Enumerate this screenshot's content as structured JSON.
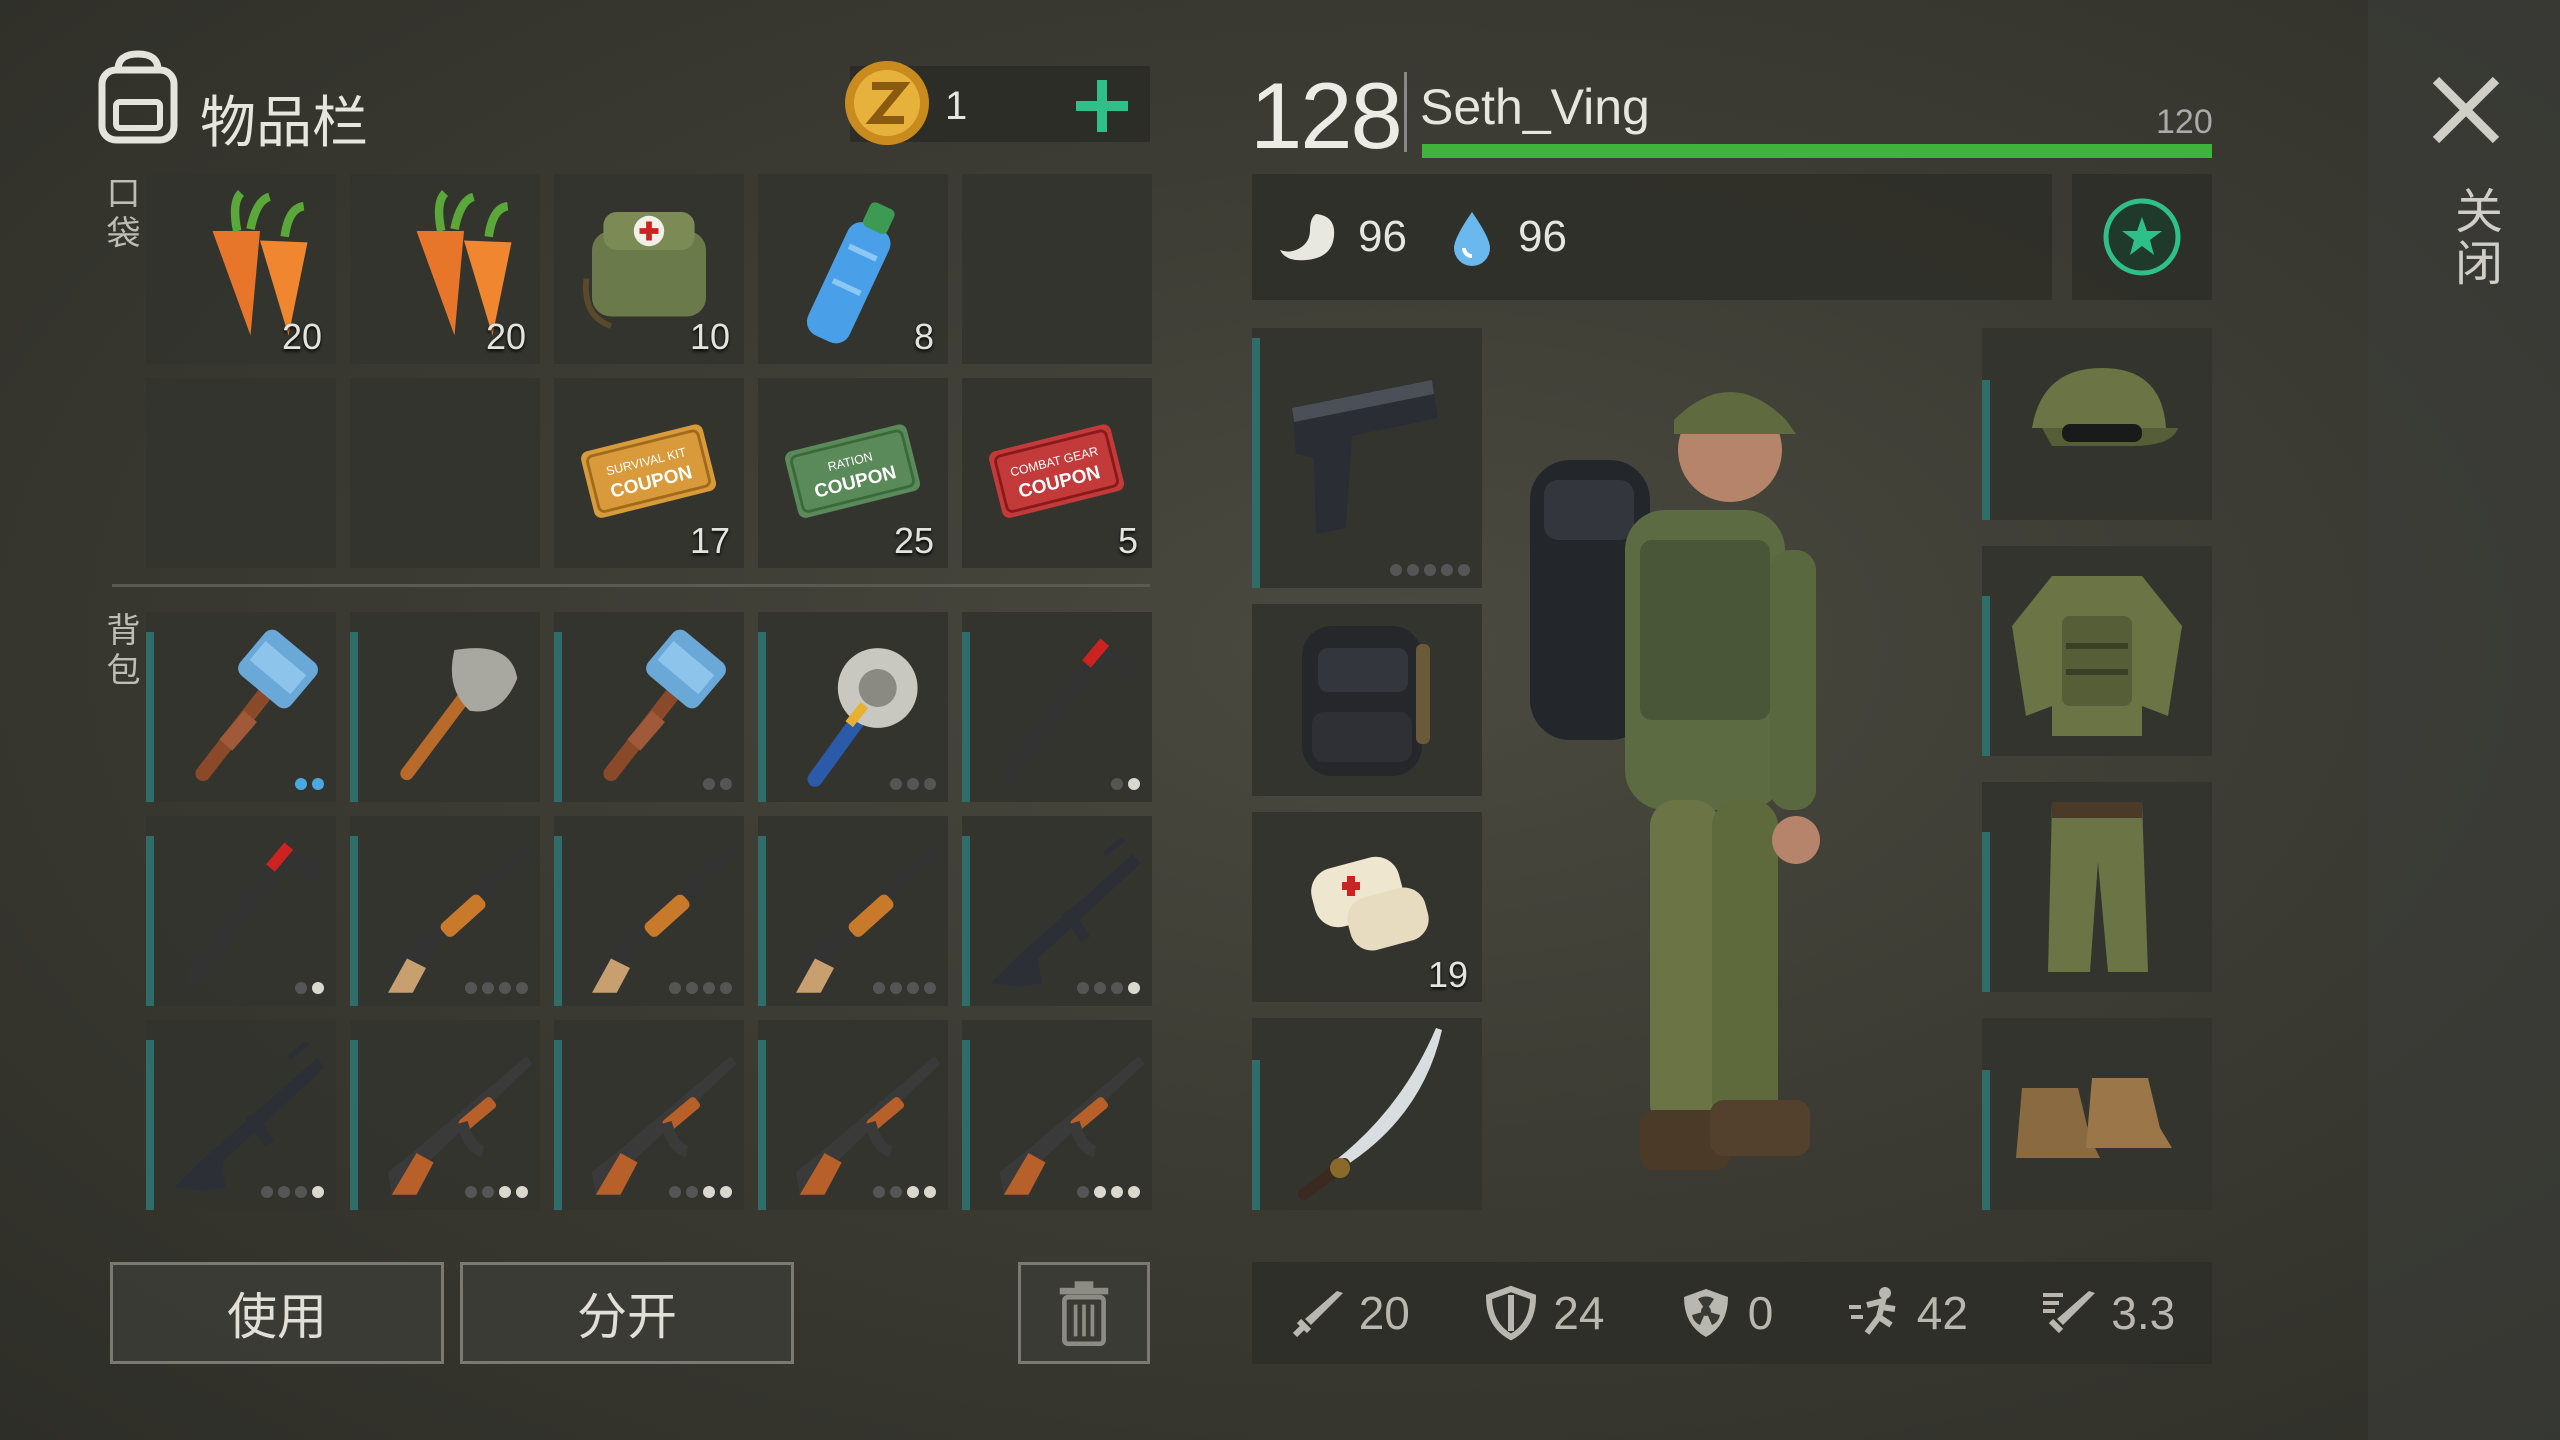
{
  "inventory": {
    "title": "物品栏",
    "coins": "1",
    "pocket_label": "口袋",
    "backpack_label": "背包",
    "pocket": [
      {
        "icon": "carrot-icon",
        "qty": "20"
      },
      {
        "icon": "carrot-icon",
        "qty": "20"
      },
      {
        "icon": "first-aid-bag-icon",
        "qty": "10"
      },
      {
        "icon": "water-bottle-icon",
        "qty": "8"
      },
      {
        "icon": "empty",
        "qty": ""
      },
      {
        "icon": "empty",
        "qty": ""
      },
      {
        "icon": "empty",
        "qty": ""
      },
      {
        "icon": "survival-kit-coupon-icon",
        "qty": "17",
        "text1": "SURVIVAL KIT",
        "text2": "COUPON"
      },
      {
        "icon": "ration-coupon-icon",
        "qty": "25",
        "text1": "RATION",
        "text2": "COUPON"
      },
      {
        "icon": "combat-gear-coupon-icon",
        "qty": "5",
        "text1": "COMBAT GEAR",
        "text2": "COUPON"
      }
    ],
    "backpack": [
      {
        "icon": "hammer-icon",
        "dots": [
          2,
          2
        ]
      },
      {
        "icon": "shovel-icon",
        "dots": [
          0,
          0
        ]
      },
      {
        "icon": "hammer-icon",
        "dots": [
          2,
          0
        ]
      },
      {
        "icon": "saw-mace-icon",
        "dots": [
          3,
          0
        ]
      },
      {
        "icon": "crowbar-icon",
        "dots": [
          2,
          1
        ]
      },
      {
        "icon": "crowbar-icon",
        "dots": [
          2,
          1
        ]
      },
      {
        "icon": "shotgun-icon",
        "dots": [
          4,
          0
        ]
      },
      {
        "icon": "shotgun-icon",
        "dots": [
          4,
          0
        ]
      },
      {
        "icon": "shotgun-icon",
        "dots": [
          4,
          0
        ]
      },
      {
        "icon": "assault-rifle-icon",
        "dots": [
          4,
          1
        ]
      },
      {
        "icon": "assault-rifle-icon",
        "dots": [
          4,
          1
        ]
      },
      {
        "icon": "ak-rifle-icon",
        "dots": [
          4,
          2
        ]
      },
      {
        "icon": "ak-rifle-icon",
        "dots": [
          4,
          2
        ]
      },
      {
        "icon": "ak-rifle-icon",
        "dots": [
          4,
          2
        ]
      },
      {
        "icon": "ak-rifle-icon",
        "dots": [
          4,
          3
        ]
      }
    ],
    "use_label": "使用",
    "split_label": "分开"
  },
  "player": {
    "level": "128",
    "name": "Seth_Ving",
    "health_max": "120",
    "health_fraction": 1.0,
    "food": "96",
    "water": "96",
    "bandage_qty": "19"
  },
  "stats": {
    "damage": "20",
    "armor": "24",
    "toxic_armor": "0",
    "speed": "42",
    "attack_speed": "3.3"
  },
  "close_label": "关闭",
  "colors": {
    "health": "#3fb43c",
    "accent": "#2fc08a",
    "durability": "#2f6d6a"
  }
}
